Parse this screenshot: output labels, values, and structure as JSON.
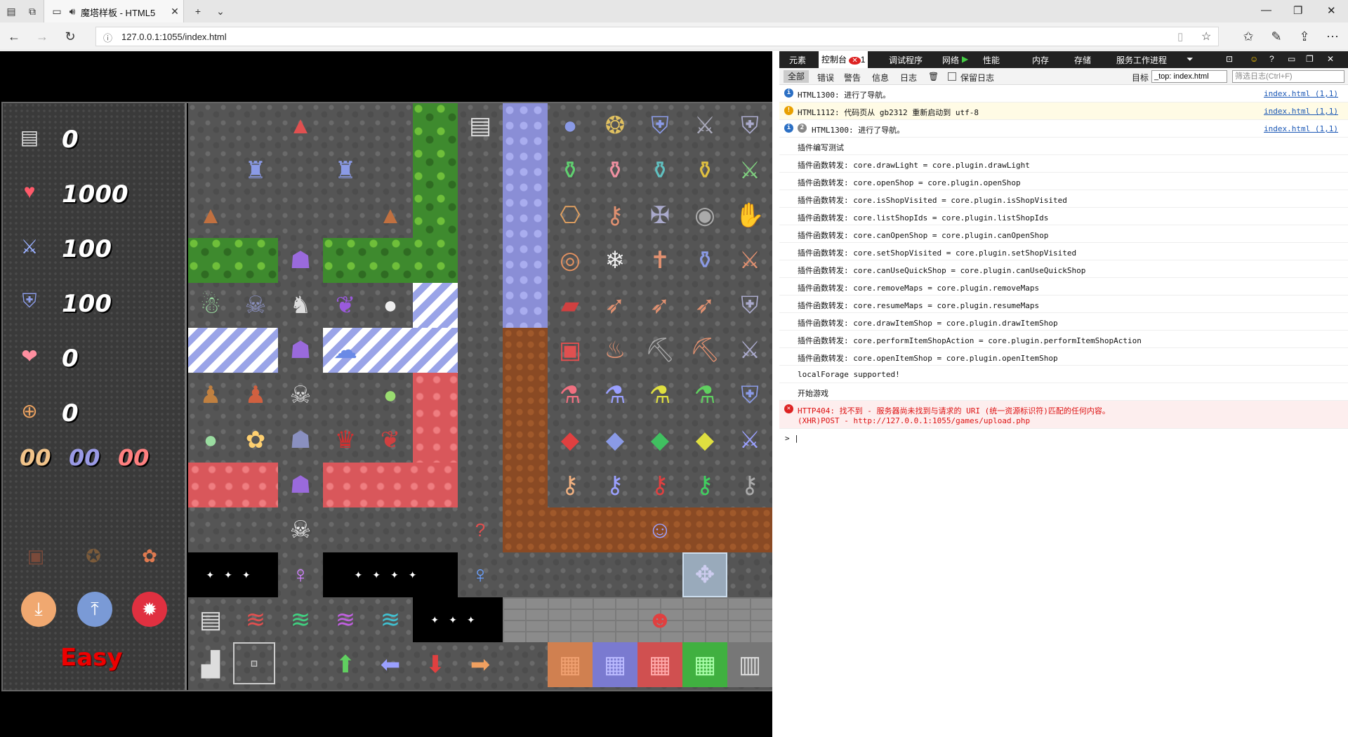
{
  "browser": {
    "tab_title": "魔塔样板 - HTML5",
    "url": "127.0.0.1:1055/index.html"
  },
  "game": {
    "stats": [
      {
        "icon": "floor-icon",
        "value": "0"
      },
      {
        "icon": "heart-icon",
        "value": "1000"
      },
      {
        "icon": "sword-icon",
        "value": "100"
      },
      {
        "icon": "shield-icon",
        "value": "100"
      },
      {
        "icon": "magic-defense-icon",
        "value": "0"
      },
      {
        "icon": "coin-icon",
        "value": "0"
      }
    ],
    "keys": {
      "yellow": "00",
      "blue": "00",
      "red": "00"
    },
    "difficulty": "Easy",
    "colors": {
      "key_yellow": "#f2c48a",
      "key_blue": "#9a9ae6",
      "key_red": "#ff8080",
      "difficulty": "#ee0000"
    }
  },
  "devtools": {
    "tabs": [
      "元素",
      "控制台",
      "调试程序",
      "网络",
      "性能",
      "内存",
      "存储",
      "服务工作进程"
    ],
    "error_count": "1",
    "filters": [
      "全部",
      "错误",
      "警告",
      "信息",
      "日志"
    ],
    "preserve_log": "保留日志",
    "target_label": "目标",
    "target_value": "_top: index.html",
    "filter_placeholder": "筛选日志(Ctrl+F)",
    "console": [
      {
        "type": "info",
        "badge": "",
        "text": "HTML1300: 进行了导航。",
        "src": "index.html (1,1)"
      },
      {
        "type": "warn",
        "badge": "",
        "text": "HTML1112: 代码页从 gb2312 重新启动到 utf-8",
        "src": "index.html (1,1)"
      },
      {
        "type": "info",
        "badge": "2",
        "text": "HTML1300: 进行了导航。",
        "src": "index.html (1,1)"
      },
      {
        "type": "log",
        "text": "插件编写测试"
      },
      {
        "type": "log",
        "text": "插件函数转发: core.drawLight = core.plugin.drawLight"
      },
      {
        "type": "log",
        "text": "插件函数转发: core.openShop = core.plugin.openShop"
      },
      {
        "type": "log",
        "text": "插件函数转发: core.isShopVisited = core.plugin.isShopVisited"
      },
      {
        "type": "log",
        "text": "插件函数转发: core.listShopIds = core.plugin.listShopIds"
      },
      {
        "type": "log",
        "text": "插件函数转发: core.canOpenShop = core.plugin.canOpenShop"
      },
      {
        "type": "log",
        "text": "插件函数转发: core.setShopVisited = core.plugin.setShopVisited"
      },
      {
        "type": "log",
        "text": "插件函数转发: core.canUseQuickShop = core.plugin.canUseQuickShop"
      },
      {
        "type": "log",
        "text": "插件函数转发: core.removeMaps = core.plugin.removeMaps"
      },
      {
        "type": "log",
        "text": "插件函数转发: core.resumeMaps = core.plugin.resumeMaps"
      },
      {
        "type": "log",
        "text": "插件函数转发: core.drawItemShop = core.plugin.drawItemShop"
      },
      {
        "type": "log",
        "text": "插件函数转发: core.performItemShopAction = core.plugin.performItemShopAction"
      },
      {
        "type": "log",
        "text": "插件函数转发: core.openItemShop = core.plugin.openItemShop"
      },
      {
        "type": "log",
        "text": "localForage supported!"
      },
      {
        "type": "log",
        "text": "开始游戏"
      }
    ],
    "error": {
      "line1": "HTTP404: 找不到 - 服务器尚未找到与请求的 URI (统一资源标识符)匹配的任何内容。",
      "line2": "(XHR)POST - http://127.0.0.1:1055/games/upload.php"
    },
    "prompt": ">"
  }
}
